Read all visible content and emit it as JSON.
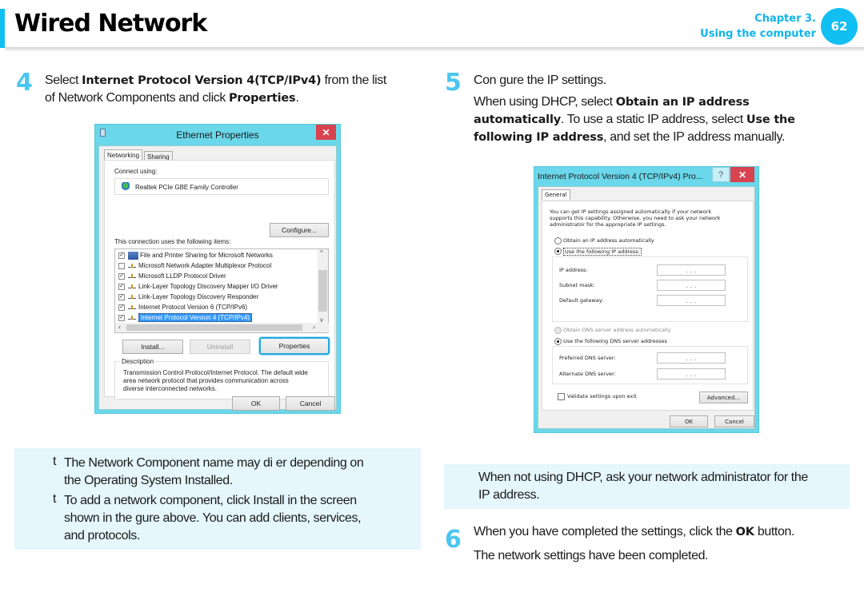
{
  "header": {
    "title": "Wired Network",
    "chapter_line1": "Chapter 3.",
    "chapter_line2": "Using the computer",
    "page_number": "62",
    "accent_color": "#12bff2"
  },
  "step4": {
    "number": "4",
    "line1_pre": "Select ",
    "line1_bold": "Internet Protocol Version 4(TCP/IPv4)",
    "line1_post": " from the list",
    "line2_pre": "of Network Components and click ",
    "line2_bold": "Properties",
    "line2_post": "."
  },
  "ethernet_dialog": {
    "title": "Ethernet Properties",
    "close_icon": "close-icon",
    "tabs": [
      "Networking",
      "Sharing"
    ],
    "connect_using_label": "Connect using:",
    "adapter": "Realtek PCIe GBE Family Controller",
    "configure_button": "Configure...",
    "items_label": "This connection uses the following items:",
    "items": [
      {
        "label": "File and Printer Sharing for Microsoft Networks",
        "checked": true,
        "icon": "computer-icon"
      },
      {
        "label": "Microsoft Network Adapter Multiplexor Protocol",
        "checked": false,
        "icon": "protocol-icon"
      },
      {
        "label": "Microsoft LLDP Protocol Driver",
        "checked": true,
        "icon": "protocol-icon"
      },
      {
        "label": "Link-Layer Topology Discovery Mapper I/O Driver",
        "checked": true,
        "icon": "protocol-icon"
      },
      {
        "label": "Link-Layer Topology Discovery Responder",
        "checked": true,
        "icon": "protocol-icon"
      },
      {
        "label": "Internet Protocol Version 6 (TCP/IPv6)",
        "checked": true,
        "icon": "protocol-icon"
      },
      {
        "label": "Internet Protocol Version 4 (TCP/IPv4)",
        "checked": true,
        "icon": "protocol-icon",
        "selected": true
      }
    ],
    "install_button": "Install...",
    "uninstall_button": "Uninstall",
    "properties_button": "Properties",
    "description_label": "Description",
    "description_lines": [
      "Transmission Control Protocol/Internet Protocol. The default wide",
      "area network protocol that provides communication across",
      "diverse interconnected networks."
    ],
    "ok_button": "OK",
    "cancel_button": "Cancel"
  },
  "step5": {
    "number": "5",
    "line1": "Con  gure the IP settings.",
    "line2_pre": "When using DHCP, select ",
    "line2_bold": "Obtain an IP address",
    "line3_bold1": "automatically",
    "line3_mid": ". To use a static IP address, select ",
    "line3_bold2": "Use the",
    "line4_bold": "following IP address",
    "line4_post": ", and set the IP address manually."
  },
  "ipv4_dialog": {
    "title": "Internet Protocol Version 4 (TCP/IPv4) Pro...",
    "help_label": "?",
    "tab": "General",
    "intro_lines": [
      "You can get IP settings assigned automatically if your network",
      "supports this capability. Otherwise, you need to ask your network",
      "administrator for the appropriate IP settings."
    ],
    "radio_obtain_ip": "Obtain an IP address automatically",
    "radio_use_ip": "Use the following IP address:",
    "ip_address_label": "IP address:",
    "subnet_mask_label": "Subnet mask:",
    "default_gateway_label": "Default gateway:",
    "ip_placeholder": ".   .   .",
    "radio_obtain_dns": "Obtain DNS server address automatically",
    "radio_use_dns": "Use the following DNS server addresses",
    "preferred_dns_label": "Preferred DNS server:",
    "alternate_dns_label": "Alternate DNS server:",
    "validate_checkbox": "Validate settings upon exit",
    "advanced_button": "Advanced...",
    "ok_button": "OK",
    "cancel_button": "Cancel"
  },
  "note_left": {
    "bullet": "t",
    "item1_line1": "The Network Component name may di  er depending on",
    "item1_line2": "the Operating System Installed.",
    "item2_line1": "To add a network component, click Install in the screen",
    "item2_line2": "shown in the   gure above. You can add clients, services,",
    "item2_line3": "and protocols."
  },
  "note_right": {
    "line1": "When not using DHCP, ask your network administrator for the",
    "line2": "IP address."
  },
  "step6": {
    "number": "6",
    "line1_pre": "When you have completed the settings, click the ",
    "line1_bold": "OK",
    "line1_post": " button.",
    "line2": "The network settings have been completed."
  }
}
